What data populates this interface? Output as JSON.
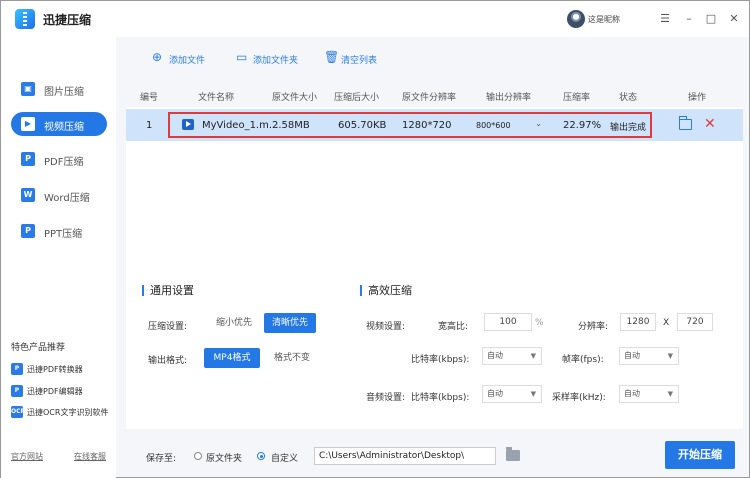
{
  "app": {
    "title": "迅捷压缩",
    "user_name": "这是昵称"
  },
  "window_controls": {
    "menu": "☰",
    "minimize": "–",
    "maximize": "□",
    "close": "✕"
  },
  "sidebar": {
    "items": [
      {
        "label": "图片压缩",
        "icon": "image-icon",
        "active": false
      },
      {
        "label": "视频压缩",
        "icon": "video-icon",
        "active": true
      },
      {
        "label": "PDF压缩",
        "icon": "pdf-icon",
        "active": false
      },
      {
        "label": "Word压缩",
        "icon": "word-icon",
        "active": false
      },
      {
        "label": "PPT压缩",
        "icon": "ppt-icon",
        "active": false
      }
    ],
    "featured_title": "特色产品推荐",
    "featured": [
      {
        "label": "迅捷PDF转换器"
      },
      {
        "label": "迅捷PDF编辑器"
      },
      {
        "label": "迅捷OCR文字识别软件"
      }
    ],
    "official_site": "官方网站",
    "online_support": "在线客服"
  },
  "toolbar": {
    "add_file": "添加文件",
    "add_folder": "添加文件夹",
    "clear_list": "清空列表"
  },
  "table": {
    "headers": [
      "编号",
      "文件名称",
      "原文件大小",
      "压缩后大小",
      "原文件分辨率",
      "输出分辨率",
      "压缩率",
      "状态",
      "操作"
    ],
    "rows": [
      {
        "index": "1",
        "name": "MyVideo_1.m...",
        "original_size": "2.58MB",
        "compressed_size": "605.70KB",
        "original_resolution": "1280*720",
        "output_resolution": "800*600",
        "ratio": "22.97%",
        "status": "输出完成"
      }
    ]
  },
  "general": {
    "title": "通用设置",
    "compress_label": "压缩设置:",
    "compress_opts": [
      "缩小优先",
      "清晰优先"
    ],
    "format_label": "输出格式:",
    "format_opts": [
      "MP4格式",
      "格式不变"
    ]
  },
  "advanced": {
    "title": "高效压缩",
    "video_label": "视频设置:",
    "aspect_label": "宽高比:",
    "aspect_value": "100",
    "aspect_unit": "%",
    "resolution_label": "分辨率:",
    "res_w": "1280",
    "res_x": "X",
    "res_h": "720",
    "bitrate_label": "比特率(kbps):",
    "bitrate_value": "自动",
    "fps_label": "帧率(fps):",
    "fps_value": "自动",
    "audio_label": "音频设置:",
    "audio_bitrate_label": "比特率(kbps):",
    "audio_bitrate_value": "自动",
    "samplerate_label": "采样率(kHz):",
    "samplerate_value": "自动"
  },
  "footer": {
    "save_label": "保存至:",
    "opt_original": "原文件夹",
    "opt_custom": "自定义",
    "path": "C:\\Users\\Administrator\\Desktop\\",
    "start": "开始压缩"
  },
  "colors": {
    "accent": "#2478e6",
    "highlight_border": "#e23a3a",
    "row_selected": "#cfe3fb"
  }
}
